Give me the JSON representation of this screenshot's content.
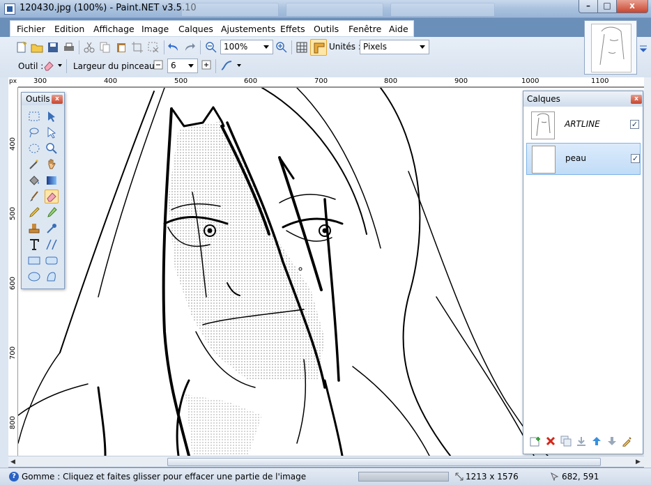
{
  "window": {
    "title": "120430.jpg (100%) - Paint.NET v3.5.10",
    "minimize": "–",
    "maximize": "□",
    "close": "x"
  },
  "menu": [
    "Fichier",
    "Edition",
    "Affichage",
    "Image",
    "Calques",
    "Ajustements",
    "Effets",
    "Outils",
    "Fenêtre",
    "Aide"
  ],
  "toolbar": {
    "zoom_value": "100%",
    "units_label": "Unités :",
    "units_value": "Pixels",
    "tool_label": "Outil :",
    "brush_width_label": "Largeur du pinceau :",
    "brush_width_value": "6"
  },
  "rulers": {
    "horizontal": [
      "300",
      "400",
      "500",
      "600",
      "700",
      "800",
      "900",
      "1000",
      "1100"
    ],
    "vertical": [
      "400",
      "500",
      "600",
      "700",
      "800"
    ],
    "corner": "px"
  },
  "tools_panel": {
    "title": "Outils",
    "tools": [
      "rectangle-select",
      "move-selection",
      "lasso-select",
      "move-selected",
      "ellipse-select",
      "zoom",
      "magic-wand",
      "pan",
      "paint-bucket",
      "gradient",
      "paintbrush",
      "eraser",
      "pencil",
      "color-picker",
      "clone-stamp",
      "recolor",
      "text",
      "line-curve",
      "rectangle",
      "rounded-rectangle",
      "ellipse",
      "freeform-shape"
    ],
    "selected_tool": "eraser"
  },
  "layers_panel": {
    "title": "Calques",
    "layers": [
      {
        "name": "ARTLINE",
        "visible": true,
        "selected": false
      },
      {
        "name": "peau",
        "visible": true,
        "selected": true
      }
    ]
  },
  "status": {
    "message": "Gomme : Cliquez et faites glisser pour effacer une partie de l'image",
    "image_size": "1213 x 1576",
    "cursor_position": "682, 591"
  },
  "colors": {
    "accent": "#2a62c5",
    "selection": "#c1dcf7",
    "chrome": "#dde7f2"
  }
}
